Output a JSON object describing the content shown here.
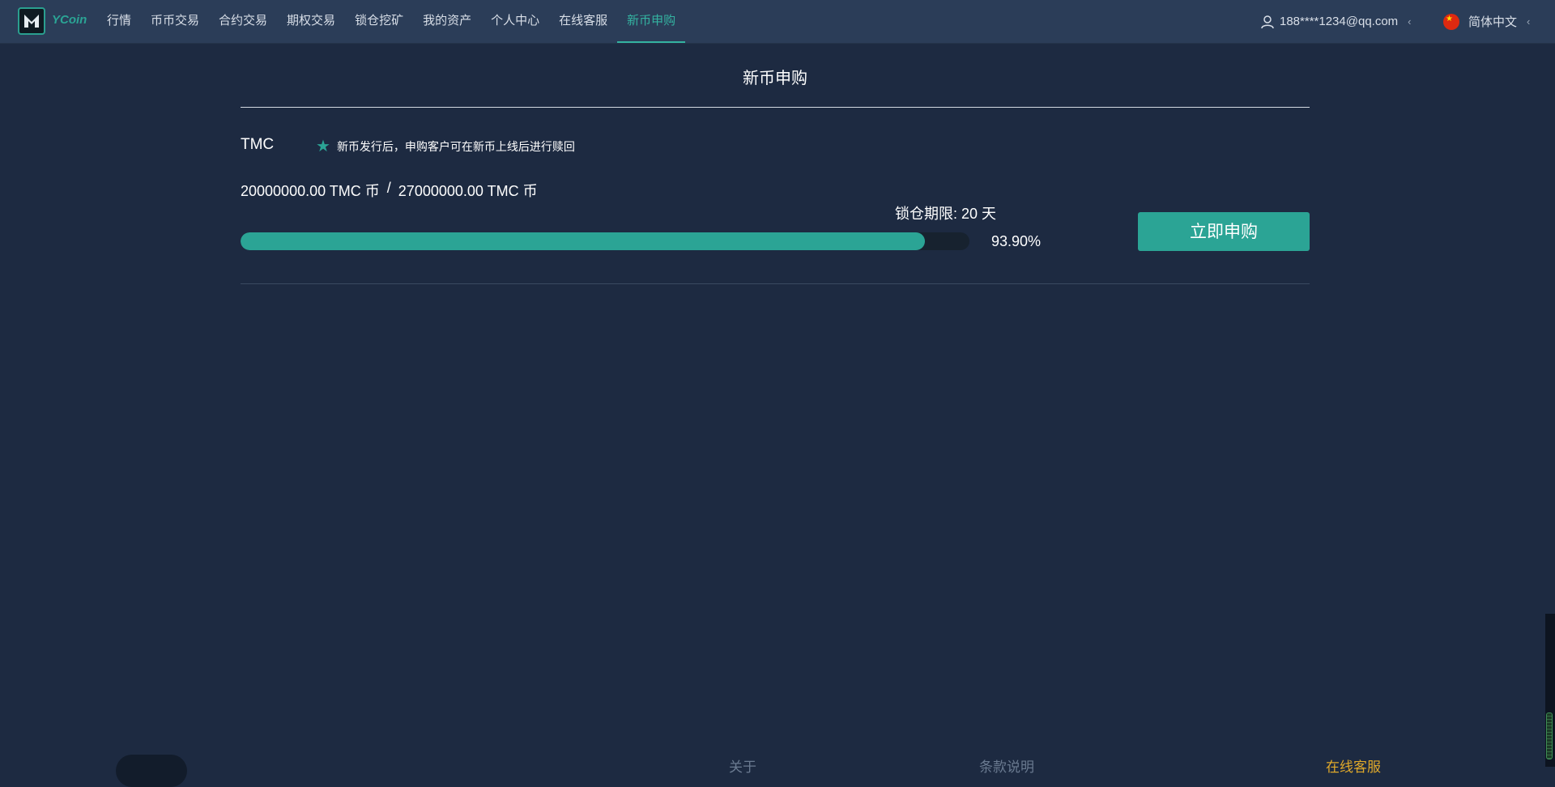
{
  "header": {
    "brand": "YCoin",
    "nav": [
      {
        "label": "行情",
        "active": false
      },
      {
        "label": "币币交易",
        "active": false
      },
      {
        "label": "合约交易",
        "active": false
      },
      {
        "label": "期权交易",
        "active": false
      },
      {
        "label": "锁仓挖矿",
        "active": false
      },
      {
        "label": "我的资产",
        "active": false
      },
      {
        "label": "个人中心",
        "active": false
      },
      {
        "label": "在线客服",
        "active": false
      },
      {
        "label": "新币申购",
        "active": true
      }
    ],
    "user_email": "188****1234@qq.com",
    "language": "简体中文",
    "caret": "‹",
    "user_icon": "user-icon",
    "flag_icon": "china-flag-icon"
  },
  "page": {
    "title": "新币申购"
  },
  "subscription": {
    "coin": "TMC",
    "notice_icon": "star-icon",
    "notice": "新币发行后，申购客户可在新币上线后进行赎回",
    "subscribed": "20000000.00 TMC 币",
    "separator": "/",
    "total": "27000000.00 TMC 币",
    "lock_period": "锁仓期限: 20 天",
    "progress": 0.939,
    "progress_text": "93.90%",
    "buy_label": "立即申购"
  },
  "footer": {
    "links": [
      "关于",
      "条款说明",
      "在线客服"
    ]
  },
  "colors": {
    "accent": "#2ba495",
    "background": "#1d2a41",
    "header": "#2b3d58",
    "footer_highlight": "#e0a92a"
  }
}
